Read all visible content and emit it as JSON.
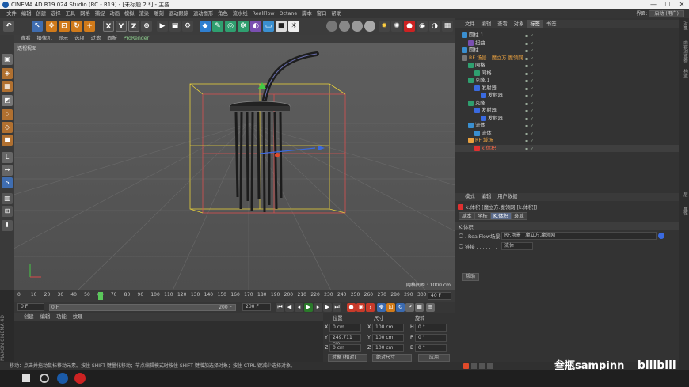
{
  "titlebar": {
    "title": "CINEMA 4D R19.024 Studio (RC - R19) - [未标题 2 *] - 主要",
    "minimize": "—",
    "maximize": "☐",
    "close": "✕"
  },
  "menubar": {
    "items": [
      "文件",
      "编辑",
      "创建",
      "选择",
      "工具",
      "网格",
      "捕捉",
      "动画",
      "模拟",
      "渲染",
      "雕刻",
      "运动跟踪",
      "运动图形",
      "角色",
      "流水线",
      "RealFlow",
      "Octane",
      "脚本",
      "窗口",
      "帮助"
    ],
    "layout_label": "界面:",
    "layout_value": "启动 (用户)"
  },
  "viewport": {
    "menu": [
      "查看",
      "摄像机",
      "显示",
      "选项",
      "过滤",
      "面板",
      "ProRender"
    ],
    "label": "透视视图",
    "grid_spacing": "网格间距 : 1000 cm"
  },
  "timeline": {
    "ticks": [
      "0",
      "10",
      "20",
      "30",
      "40",
      "50",
      "60",
      "70",
      "80",
      "90",
      "100",
      "110",
      "120",
      "130",
      "140",
      "150",
      "160",
      "170",
      "180",
      "190",
      "200",
      "210",
      "220",
      "230",
      "240",
      "250",
      "260",
      "270",
      "280",
      "290",
      "300"
    ],
    "current": "40",
    "end_label": "40 F",
    "start_field": "0 F",
    "range_start": "0 F",
    "range_end": "200 F",
    "end_field": "200 F"
  },
  "materials": {
    "tabs": [
      "创建",
      "编辑",
      "功能",
      "纹理"
    ]
  },
  "coords": {
    "headers": [
      "位置",
      "尺寸",
      "旋转"
    ],
    "rows": [
      {
        "axis": "X",
        "pos": "0 cm",
        "sl": "X",
        "size": "100 cm",
        "rl": "H",
        "rot": "0 °"
      },
      {
        "axis": "Y",
        "pos": "249.711 cm",
        "sl": "Y",
        "size": "100 cm",
        "rl": "P",
        "rot": "0 °"
      },
      {
        "axis": "Z",
        "pos": "0 cm",
        "sl": "Z",
        "size": "100 cm",
        "rl": "B",
        "rot": "0 °"
      }
    ],
    "mode": "对象 (相对)",
    "size_mode": "绝对尺寸",
    "apply": "应用"
  },
  "status": "移动：点击并拖动鼠标移动元素。按住 SHIFT 键量化移动；节点编辑模式时按住 SHIFT 键增加选择对象；按住 CTRL 键减少选择对象。",
  "objmgr": {
    "tabs": [
      "文件",
      "编辑",
      "查看",
      "对象",
      "标签",
      "书签"
    ],
    "rows": [
      {
        "name": "圆柱.1",
        "indent": 0,
        "color": "#cfcfcf"
      },
      {
        "name": "扭曲",
        "indent": 1,
        "color": "#cfcfcf"
      },
      {
        "name": "圆柱",
        "indent": 0,
        "color": "#cfcfcf"
      },
      {
        "name": "RF 场景 | 魔立方.魔领网",
        "indent": 0,
        "color": "#e8a040"
      },
      {
        "name": "网格",
        "indent": 1,
        "color": "#cfcfcf"
      },
      {
        "name": "网格",
        "indent": 2,
        "color": "#cfcfcf"
      },
      {
        "name": "克隆.1",
        "indent": 1,
        "color": "#cfcfcf"
      },
      {
        "name": "发射器",
        "indent": 2,
        "color": "#cfcfcf"
      },
      {
        "name": "发射器",
        "indent": 3,
        "color": "#cfcfcf"
      },
      {
        "name": "克隆",
        "indent": 1,
        "color": "#cfcfcf"
      },
      {
        "name": "发射器",
        "indent": 2,
        "color": "#cfcfcf"
      },
      {
        "name": "发射器",
        "indent": 3,
        "color": "#cfcfcf"
      },
      {
        "name": "流体",
        "indent": 1,
        "color": "#cfcfcf"
      },
      {
        "name": "流体",
        "indent": 2,
        "color": "#cfcfcf"
      },
      {
        "name": "RF 域场",
        "indent": 1,
        "color": "#e8a040"
      },
      {
        "name": "k.体积",
        "indent": 2,
        "color": "#ff6a4a"
      }
    ]
  },
  "attrmgr": {
    "tabs": [
      "模式",
      "编辑",
      "用户数据"
    ],
    "object_line": "k.体积 [魔立方.魔领网 [k.体积]]",
    "subtabs": [
      "基本",
      "坐标",
      "K.体积",
      "衰减"
    ],
    "section": "K.体积",
    "realflow_label": ". RealFlow场景",
    "realflow_value": "RF.场景 | 魔立方.魔领网",
    "link_label": "链接 . . . . . . .",
    "link_value": "流体",
    "help": "帮助"
  },
  "sidetabs": [
    "对象",
    "内容浏览器",
    "构造",
    "层",
    "属性"
  ],
  "watermark": "叁瓶sampinn"
}
